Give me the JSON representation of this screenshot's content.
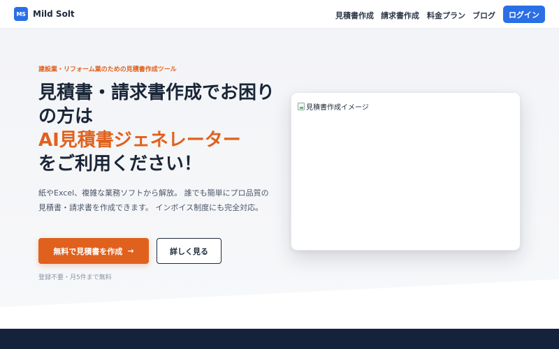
{
  "header": {
    "logo_badge": "MS",
    "brand": "Mild Solt",
    "nav": [
      "見積書作成",
      "請求書作成",
      "料金プラン",
      "ブログ"
    ],
    "login_label": "ログイン"
  },
  "hero": {
    "eyebrow": "建設業・リフォーム業のための見積書作成ツール",
    "headline_1": "見積書・請求書作成でお困りの方は",
    "headline_accent": "AI見積書ジェネレーター",
    "headline_2": "をご利用ください！",
    "description": "紙やExcel、複雑な業務ソフトから解放。 誰でも簡単にプロ品質の見積書・請求書を作成できます。 インボイス制度にも完全対応。",
    "primary_cta": "無料で見積書を作成",
    "primary_cta_arrow": "→",
    "secondary_cta": "詳しく見る",
    "note": "登録不要・月5件まで無料",
    "image_alt": "見積書作成イメージ"
  },
  "colors": {
    "brand_blue": "#2a6fe6",
    "accent_orange": "#e0611d",
    "navy": "#14233b"
  },
  "icons": {
    "cta_arrow": "arrow-right-icon",
    "broken_image": "broken-image-icon"
  }
}
